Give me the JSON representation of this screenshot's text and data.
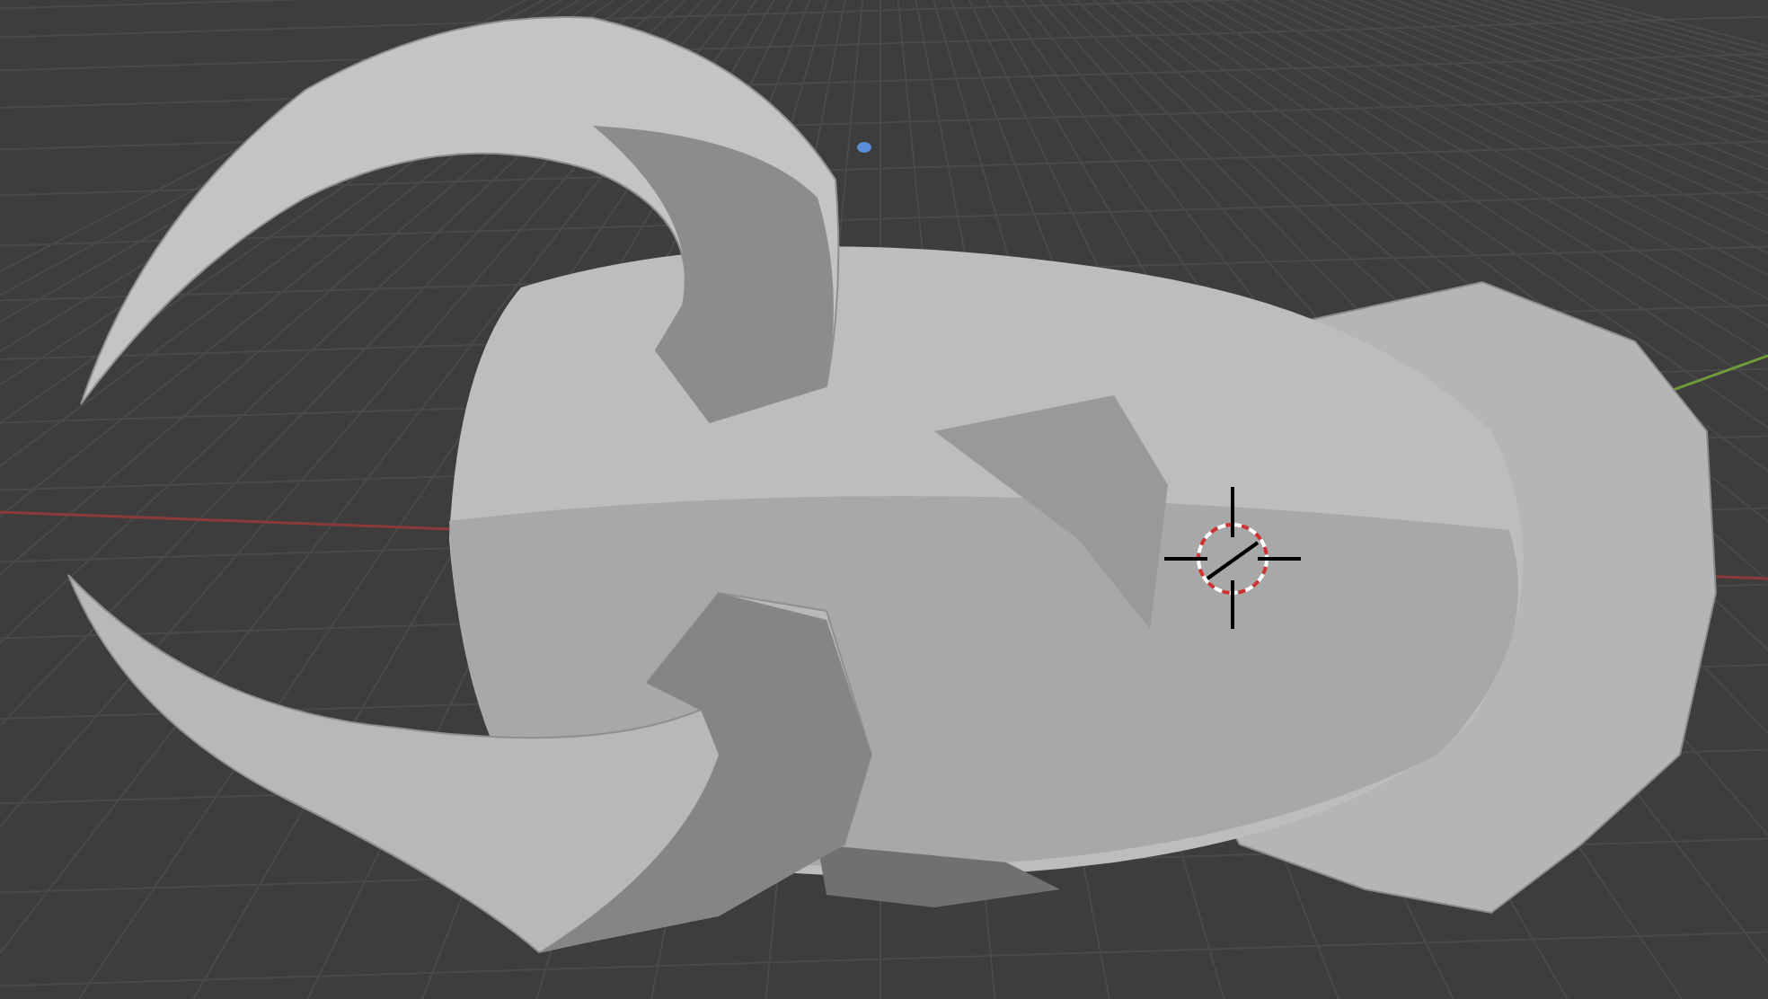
{
  "viewport": {
    "kind": "perspective",
    "show_cursor": true
  }
}
